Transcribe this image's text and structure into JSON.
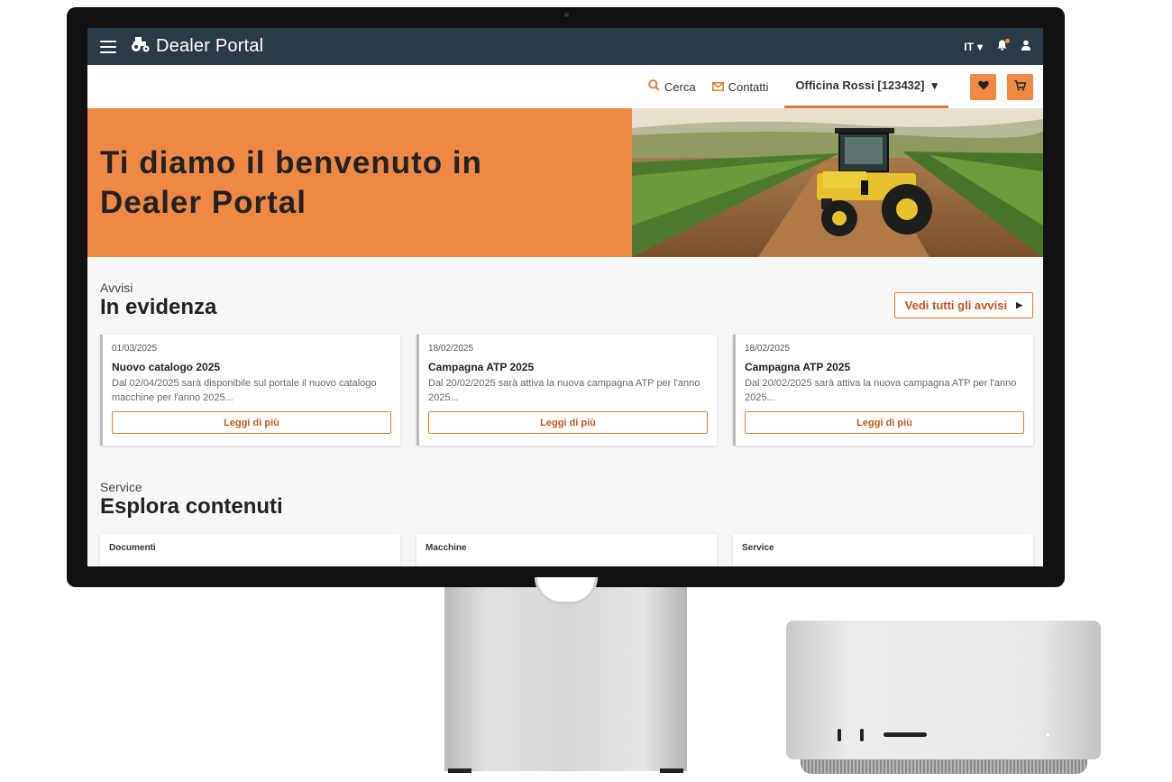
{
  "topbar": {
    "brand": "Dealer Portal",
    "language": "IT"
  },
  "subnav": {
    "search_label": "Cerca",
    "contacts_label": "Contatti",
    "account_label": "Officina Rossi [123432]"
  },
  "hero": {
    "title_line1": "Ti diamo il benvenuto in",
    "title_line2": "Dealer Portal"
  },
  "notices": {
    "kicker": "Avvisi",
    "heading": "In evidenza",
    "see_all_label": "Vedi tutti gli avvisi",
    "items": [
      {
        "date": "01/03/2025",
        "title": "Nuovo catalogo 2025",
        "text": "Dal 02/04/2025 sarà disponibile sul portale il nuovo catalogo macchine per l'anno 2025...",
        "button": "Leggi di più"
      },
      {
        "date": "18/02/2025",
        "title": "Campagna ATP 2025",
        "text": "Dal 20/02/2025 sarà attiva la nuova campagna ATP per l'anno 2025...",
        "button": "Leggi di più"
      },
      {
        "date": "18/02/2025",
        "title": "Campagna ATP 2025",
        "text": "Dal 20/02/2025 sarà attiva la nuova campagna ATP per l'anno 2025...",
        "button": "Leggi di più"
      }
    ]
  },
  "service": {
    "kicker": "Service",
    "heading": "Esplora contenuti",
    "tiles": [
      "Documenti",
      "Macchine",
      "Service"
    ]
  },
  "colors": {
    "topbar": "#2c3a47",
    "accent": "#ee8844",
    "accent_text": "#c2561b"
  }
}
